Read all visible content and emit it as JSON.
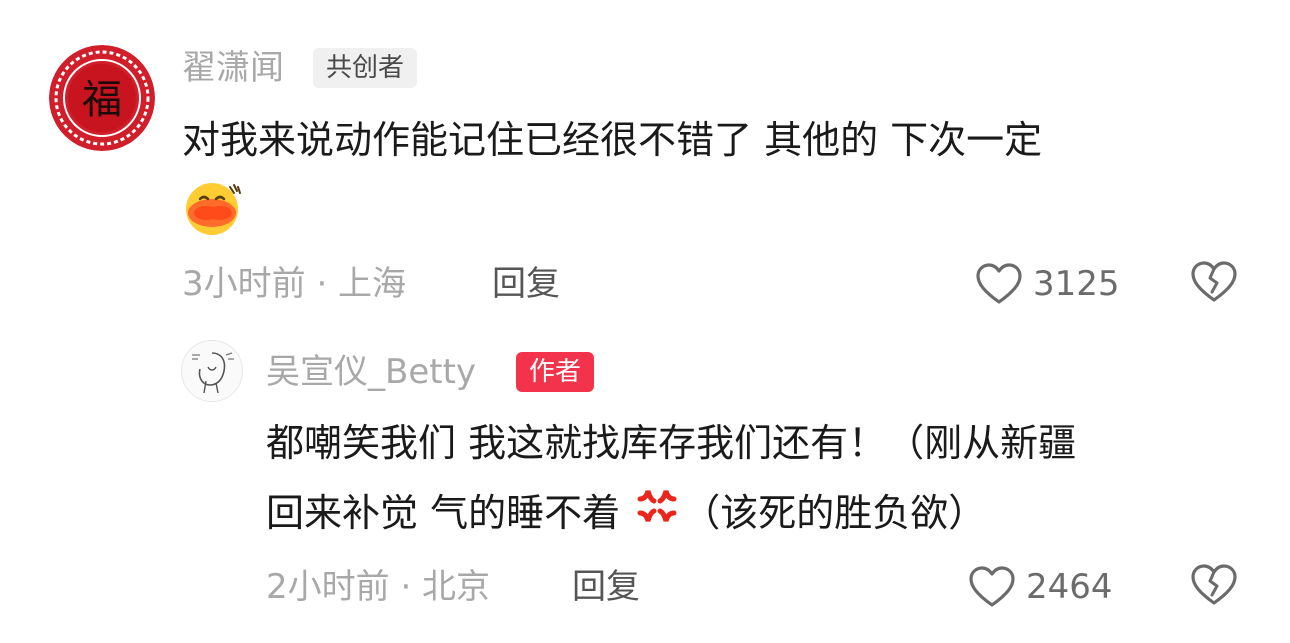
{
  "comments": [
    {
      "username": "翟潇闻",
      "badge": "共创者",
      "text_line1": "对我来说动作能记住已经很不错了 其他的 下次一定",
      "emoji": "hot-face-emoji",
      "time_location": "3小时前 · 上海",
      "reply_label": "回复",
      "likes": "3125",
      "avatar_text": "福"
    }
  ],
  "replies": [
    {
      "username": "吴宣仪_Betty",
      "badge": "作者",
      "text_line1": "都嘲笑我们 我这就找库存我们还有！（刚从新疆",
      "text_line2_part1": "回来补觉 气的睡不着",
      "emoji": "anger-symbol-emoji",
      "text_line2_part2": "（该死的胜负欲）",
      "time_location": "2小时前 · 北京",
      "reply_label": "回复",
      "likes": "2464"
    }
  ],
  "colors": {
    "badge_author": "#f2334b",
    "meta_gray": "#a8a8a8",
    "avatar_red": "#d01f2a"
  }
}
